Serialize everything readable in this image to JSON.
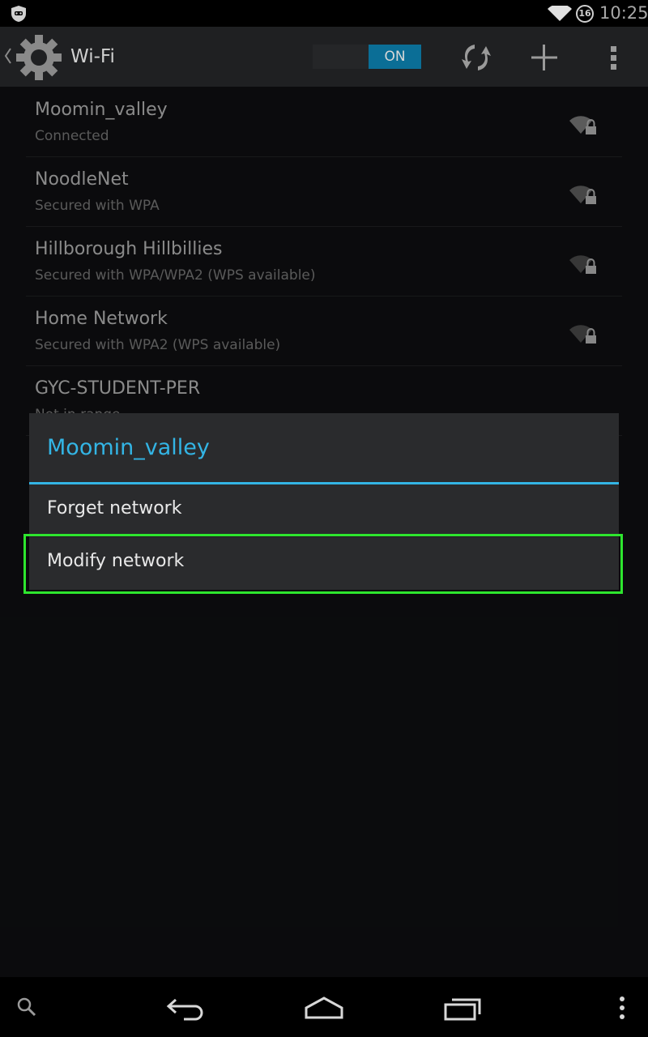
{
  "status_bar": {
    "clock": "10:25",
    "badge": "16",
    "icons": [
      "privacy-guard-icon",
      "wifi-signal-icon",
      "notification-badge-icon"
    ]
  },
  "action_bar": {
    "title": "Wi-Fi",
    "toggle_state": "ON",
    "icons": [
      "settings-gear-icon",
      "wps-icon",
      "add-icon",
      "overflow-menu-icon"
    ]
  },
  "networks": [
    {
      "name": "Moomin_valley",
      "status": "Connected"
    },
    {
      "name": "NoodleNet",
      "status": "Secured with WPA"
    },
    {
      "name": "Hillborough Hillbillies",
      "status": "Secured with WPA/WPA2 (WPS available)"
    },
    {
      "name": "Home Network",
      "status": "Secured with WPA2 (WPS available)"
    },
    {
      "name": "GYC-STUDENT-PER",
      "status": "Not in range"
    }
  ],
  "dialog": {
    "title": "Moomin_valley",
    "items": [
      "Forget network",
      "Modify network"
    ]
  },
  "colors": {
    "accent": "#33b5e5",
    "highlight": "#2ee62e",
    "toggle_on": "#0b6e96"
  },
  "nav_bar": {
    "icons": [
      "search-icon",
      "back-icon",
      "home-icon",
      "recents-icon",
      "menu-dots-icon"
    ]
  }
}
